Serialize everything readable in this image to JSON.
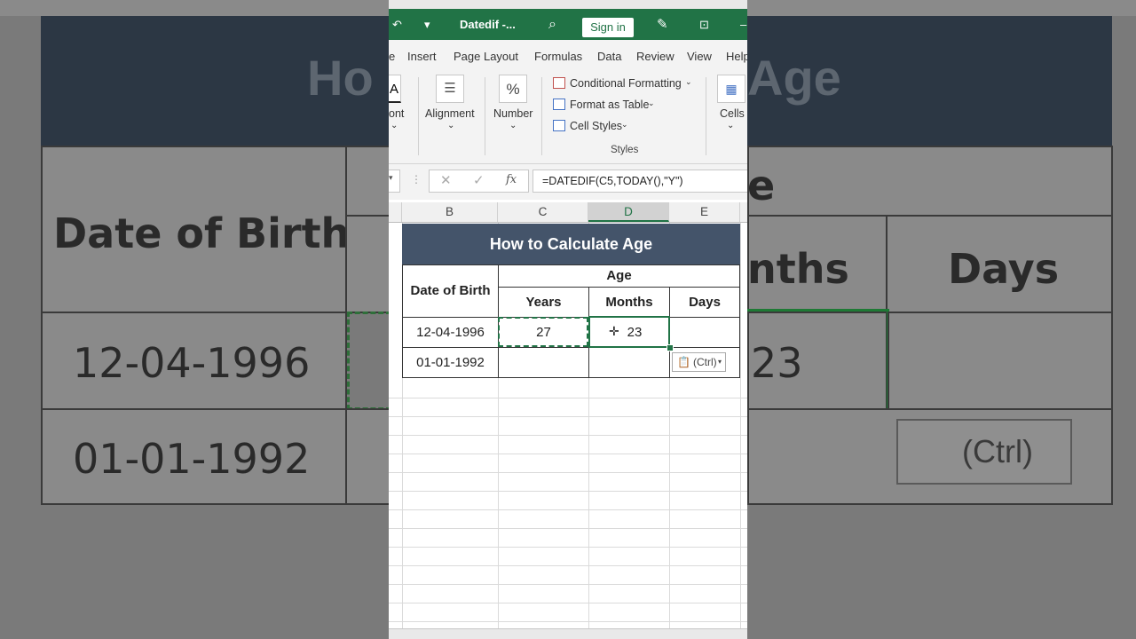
{
  "background": {
    "title": "How to Calculate Age",
    "header_date_of_birth": "Date of Birth",
    "header_months": "Months",
    "header_days": "Days",
    "dob_1": "12-04-1996",
    "dob_2": "01-01-1992",
    "months_value": "23",
    "paste_label": "(Ctrl)"
  },
  "titlebar": {
    "filename": "Datedif  -...",
    "sign_in": "Sign in"
  },
  "ribbon_tabs": [
    "e",
    "Insert",
    "Page Layout",
    "Formulas",
    "Data",
    "Review",
    "View",
    "Help"
  ],
  "ribbon": {
    "font_label": "ont",
    "alignment_label": "Alignment",
    "number_label": "Number",
    "conditional_formatting": "Conditional Formatting",
    "format_as_table": "Format as Table",
    "cell_styles": "Cell Styles",
    "styles_group": "Styles",
    "cells_label": "Cells"
  },
  "formula_bar": {
    "fx": "fx",
    "formula": "=DATEDIF(C5,TODAY(),\"Y\")"
  },
  "columns": [
    "B",
    "C",
    "D",
    "E"
  ],
  "sheet": {
    "title": "How to Calculate Age",
    "date_of_birth": "Date of Birth",
    "age": "Age",
    "years": "Years",
    "months": "Months",
    "days": "Days",
    "rows": [
      {
        "dob": "12-04-1996",
        "years": "27",
        "months": "23",
        "days": ""
      },
      {
        "dob": "01-01-1992",
        "years": "",
        "months": "",
        "days": ""
      }
    ],
    "paste_options": "(Ctrl)"
  },
  "colors": {
    "excel_green": "#217346",
    "title_fill": "#44546a"
  }
}
